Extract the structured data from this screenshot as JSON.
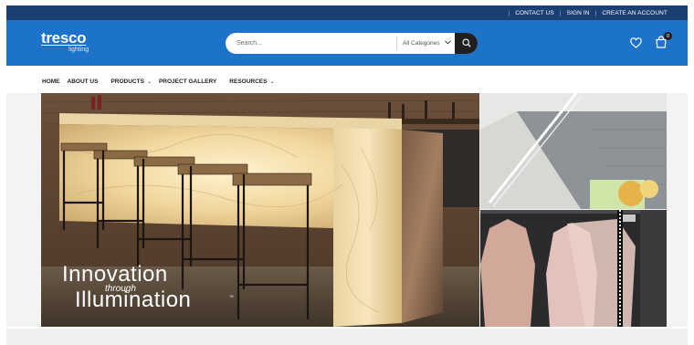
{
  "topbar": {
    "links": [
      "CONTACT US",
      "SIGN IN",
      "CREATE AN ACCOUNT"
    ]
  },
  "header": {
    "logo_main": "tresco",
    "logo_sub": "lighting",
    "search_placeholder": "Search...",
    "category_selected": "All Categories",
    "icons": [
      "heart-icon",
      "cart-icon",
      "search-icon"
    ],
    "cart_count": "0"
  },
  "nav": {
    "items": [
      {
        "label": "HOME",
        "has_dropdown": false
      },
      {
        "label": "ABOUT US",
        "has_dropdown": false
      },
      {
        "label": "PRODUCTS",
        "has_dropdown": true
      },
      {
        "label": "PROJECT GALLERY",
        "has_dropdown": false
      },
      {
        "label": "RESOURCES",
        "has_dropdown": true
      }
    ]
  },
  "hero": {
    "line1": "Innovation",
    "line2": "through",
    "line3": "Illumination",
    "trademark": "™"
  },
  "colors": {
    "topbar": "#1a3f73",
    "header": "#1d73c9",
    "search_button": "#1f1f1f"
  }
}
